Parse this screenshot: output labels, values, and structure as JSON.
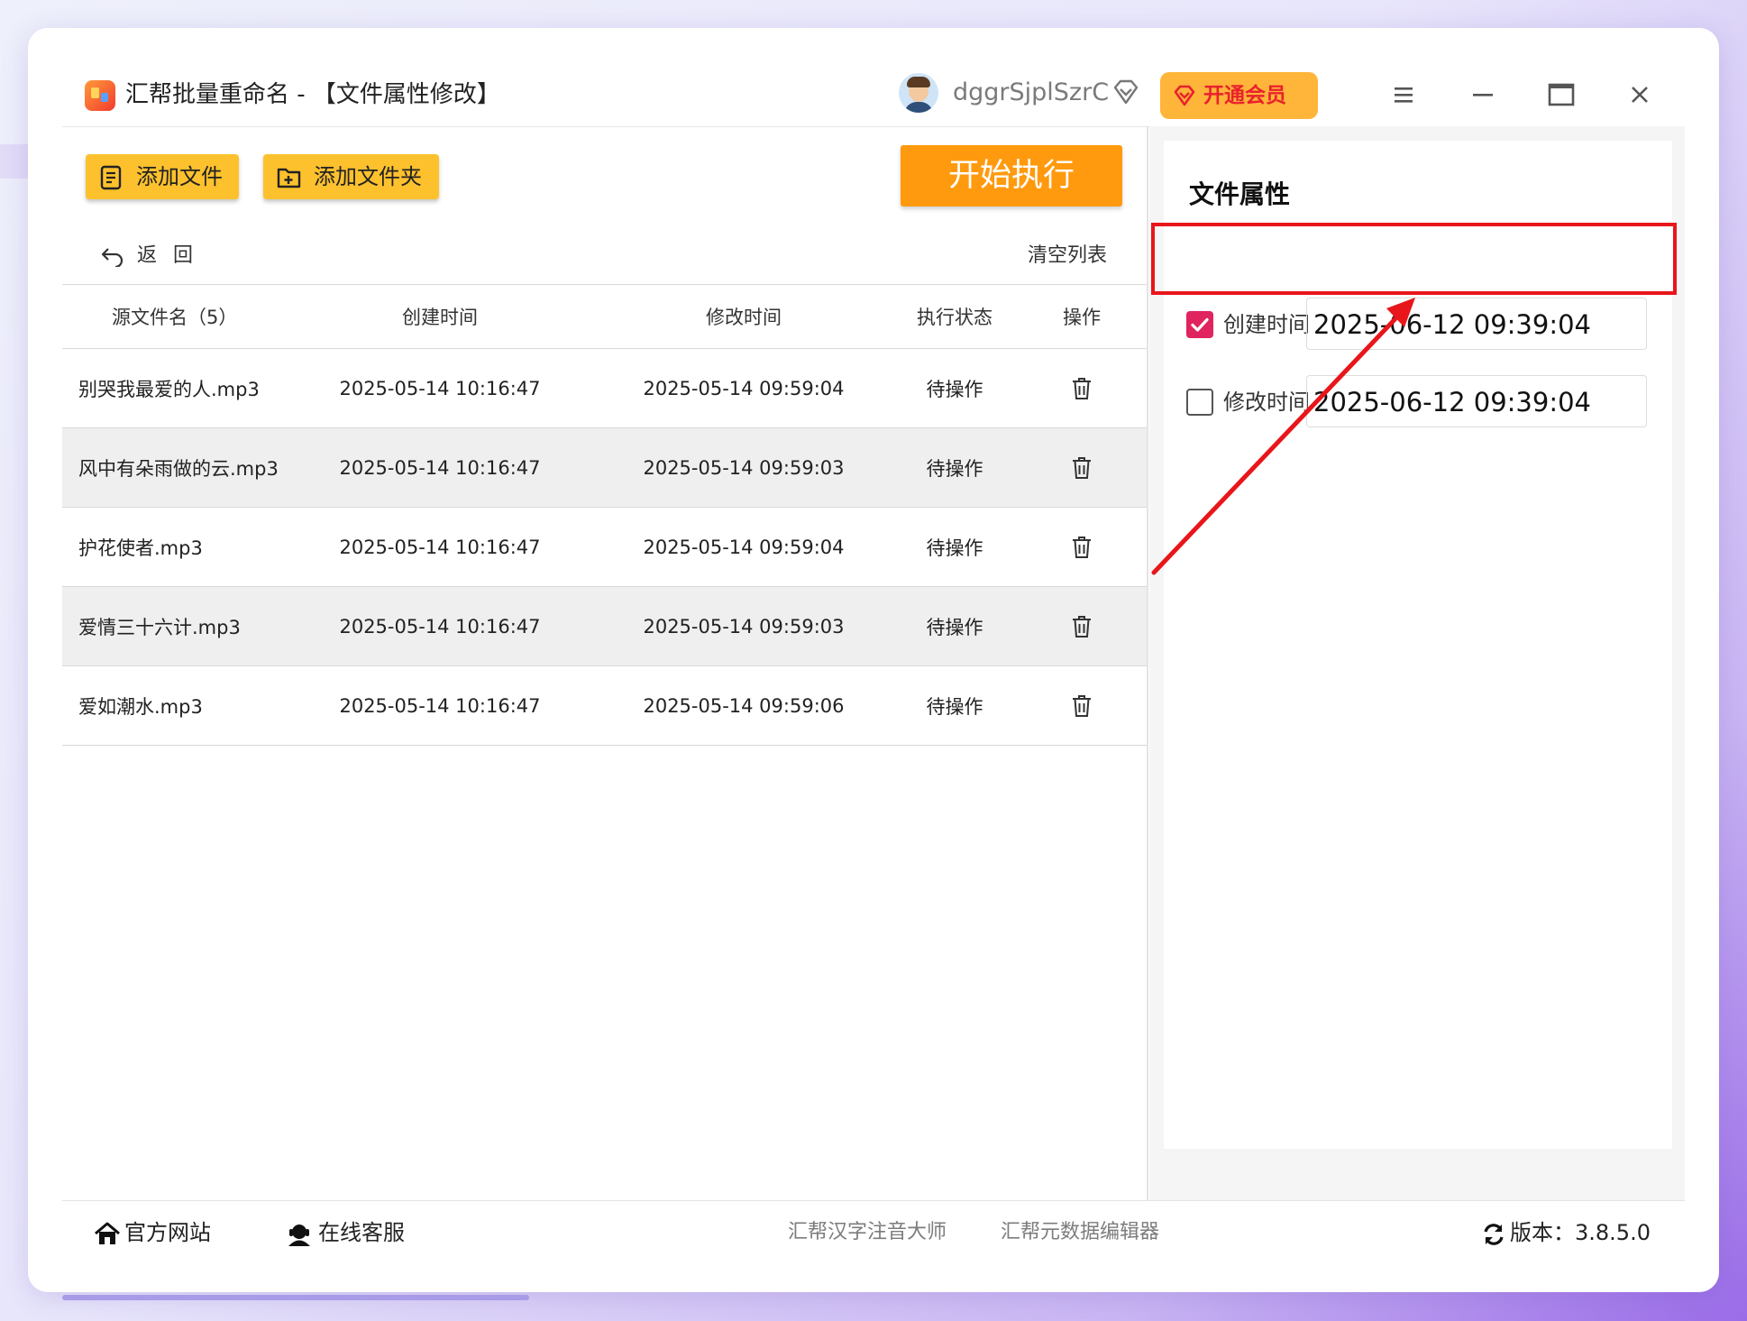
{
  "window": {
    "title": "汇帮批量重命名 - 【文件属性修改】",
    "username": "dggrSjplSzrC",
    "vip_label": "开通会员"
  },
  "toolbar": {
    "add_file": "添加文件",
    "add_folder": "添加文件夹",
    "start": "开始执行",
    "back": "返回",
    "clear": "清空列表"
  },
  "table": {
    "headers": {
      "name": "源文件名（5）",
      "ctime": "创建时间",
      "mtime": "修改时间",
      "status": "执行状态",
      "op": "操作"
    },
    "rows": [
      {
        "name": "别哭我最爱的人.mp3",
        "ctime": "2025-05-14 10:16:47",
        "mtime": "2025-05-14 09:59:04",
        "status": "待操作"
      },
      {
        "name": "风中有朵雨做的云.mp3",
        "ctime": "2025-05-14 10:16:47",
        "mtime": "2025-05-14 09:59:03",
        "status": "待操作"
      },
      {
        "name": "护花使者.mp3",
        "ctime": "2025-05-14 10:16:47",
        "mtime": "2025-05-14 09:59:04",
        "status": "待操作"
      },
      {
        "name": "爱情三十六计.mp3",
        "ctime": "2025-05-14 10:16:47",
        "mtime": "2025-05-14 09:59:03",
        "status": "待操作"
      },
      {
        "name": "爱如潮水.mp3",
        "ctime": "2025-05-14 10:16:47",
        "mtime": "2025-05-14 09:59:06",
        "status": "待操作"
      }
    ]
  },
  "panel": {
    "title": "文件属性",
    "create": {
      "label": "创建时间",
      "value": "2025-06-12 09:39:04",
      "checked": true
    },
    "modify": {
      "label": "修改时间",
      "value": "2025-06-12 09:39:04",
      "checked": false
    }
  },
  "footer": {
    "website": "官方网站",
    "support": "在线客服",
    "link1": "汇帮汉字注音大师",
    "link2": "汇帮元数据编辑器",
    "version": "版本：3.8.5.0"
  },
  "colors": {
    "accent_yellow": "#fcc12d",
    "start_orange": "#ff9a0e",
    "checkbox_pink": "#e0245e",
    "annotation_red": "#e8161b"
  }
}
